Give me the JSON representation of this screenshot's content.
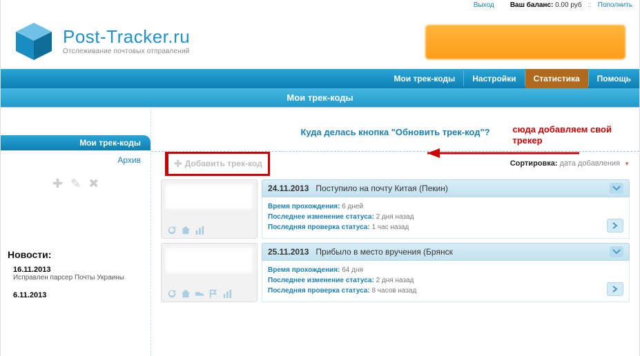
{
  "topbar": {
    "logout": "Выход",
    "balance_label": "Ваш баланс:",
    "balance_value": "0.00 руб",
    "topup": "Пополнить"
  },
  "header": {
    "site_name": "Post-Tracker.ru",
    "tagline": "Отслеживание почтовых отправлений"
  },
  "nav": {
    "my_codes": "Мои трек-коды",
    "settings": "Настройки",
    "stats": "Статистика",
    "help": "Помощь"
  },
  "subnav": {
    "title": "Мои трек-коды"
  },
  "main": {
    "info_question": "Куда делась кнопка \"Обновить трек-код\"?",
    "annotation_l1": "сюда добавляем свой",
    "annotation_l2": "трекер",
    "add_btn": "Добавить трек-код",
    "sort_label": "Сортировка:",
    "sort_value": "дата добавления"
  },
  "sidebar": {
    "tab": "Мои трек-коды",
    "archive": "Архив",
    "news_h": "Новости:",
    "news": [
      {
        "date": "16.11.2013",
        "text": "Исправлен парсер Почты Украины"
      },
      {
        "date": "6.11.2013",
        "text": ""
      }
    ]
  },
  "tracks": [
    {
      "date": "24.11.2013",
      "status": "Поступило на почту Китая (Пекин)",
      "duration_l": "Время прохождения:",
      "duration_v": "6 дней",
      "last_change_l": "Последнее изменение статуса:",
      "last_change_v": "2 дня назад",
      "last_check_l": "Последняя проверка статуса:",
      "last_check_v": "1 час назад"
    },
    {
      "date": "25.11.2013",
      "status": "Прибыло в место вручения (Брянск",
      "duration_l": "Время прохождения:",
      "duration_v": "64 дня",
      "last_change_l": "Последнее изменение статуса:",
      "last_change_v": "2 дня назад",
      "last_check_l": "Последняя проверка статуса:",
      "last_check_v": "8 часов назад"
    }
  ]
}
